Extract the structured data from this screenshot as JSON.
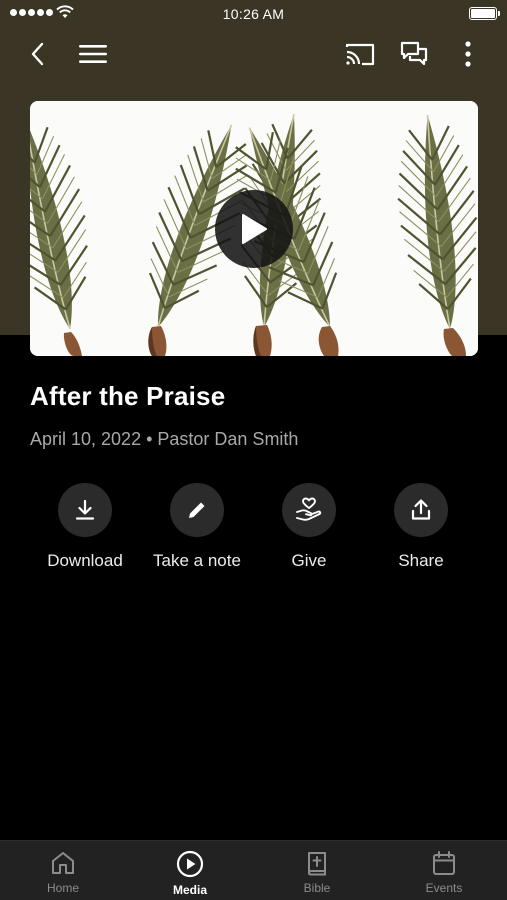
{
  "status_bar": {
    "time": "10:26 AM"
  },
  "nav": {
    "back_icon": "chevron-left-icon",
    "menu_icon": "hamburger-menu-icon",
    "cast_icon": "cast-icon",
    "chat_icon": "chat-bubbles-icon",
    "more_icon": "more-vertical-icon"
  },
  "media": {
    "title": "After the Praise",
    "date": "April 10, 2022",
    "separator": "•",
    "speaker": "Pastor Dan Smith"
  },
  "actions": [
    {
      "label": "Download",
      "icon": "download-icon"
    },
    {
      "label": "Take a note",
      "icon": "pencil-icon"
    },
    {
      "label": "Give",
      "icon": "heart-hand-icon"
    },
    {
      "label": "Share",
      "icon": "share-icon"
    }
  ],
  "tabs": [
    {
      "label": "Home",
      "icon": "home-icon",
      "active": false
    },
    {
      "label": "Media",
      "icon": "play-circle-icon",
      "active": true
    },
    {
      "label": "Bible",
      "icon": "bible-icon",
      "active": false
    },
    {
      "label": "Events",
      "icon": "calendar-icon",
      "active": false
    }
  ],
  "colors": {
    "header_background": "#3a3524",
    "page_background": "#000000",
    "tab_bar_background": "#222222",
    "action_circle": "#2b2b2b",
    "palm_green": "#6e7248"
  }
}
